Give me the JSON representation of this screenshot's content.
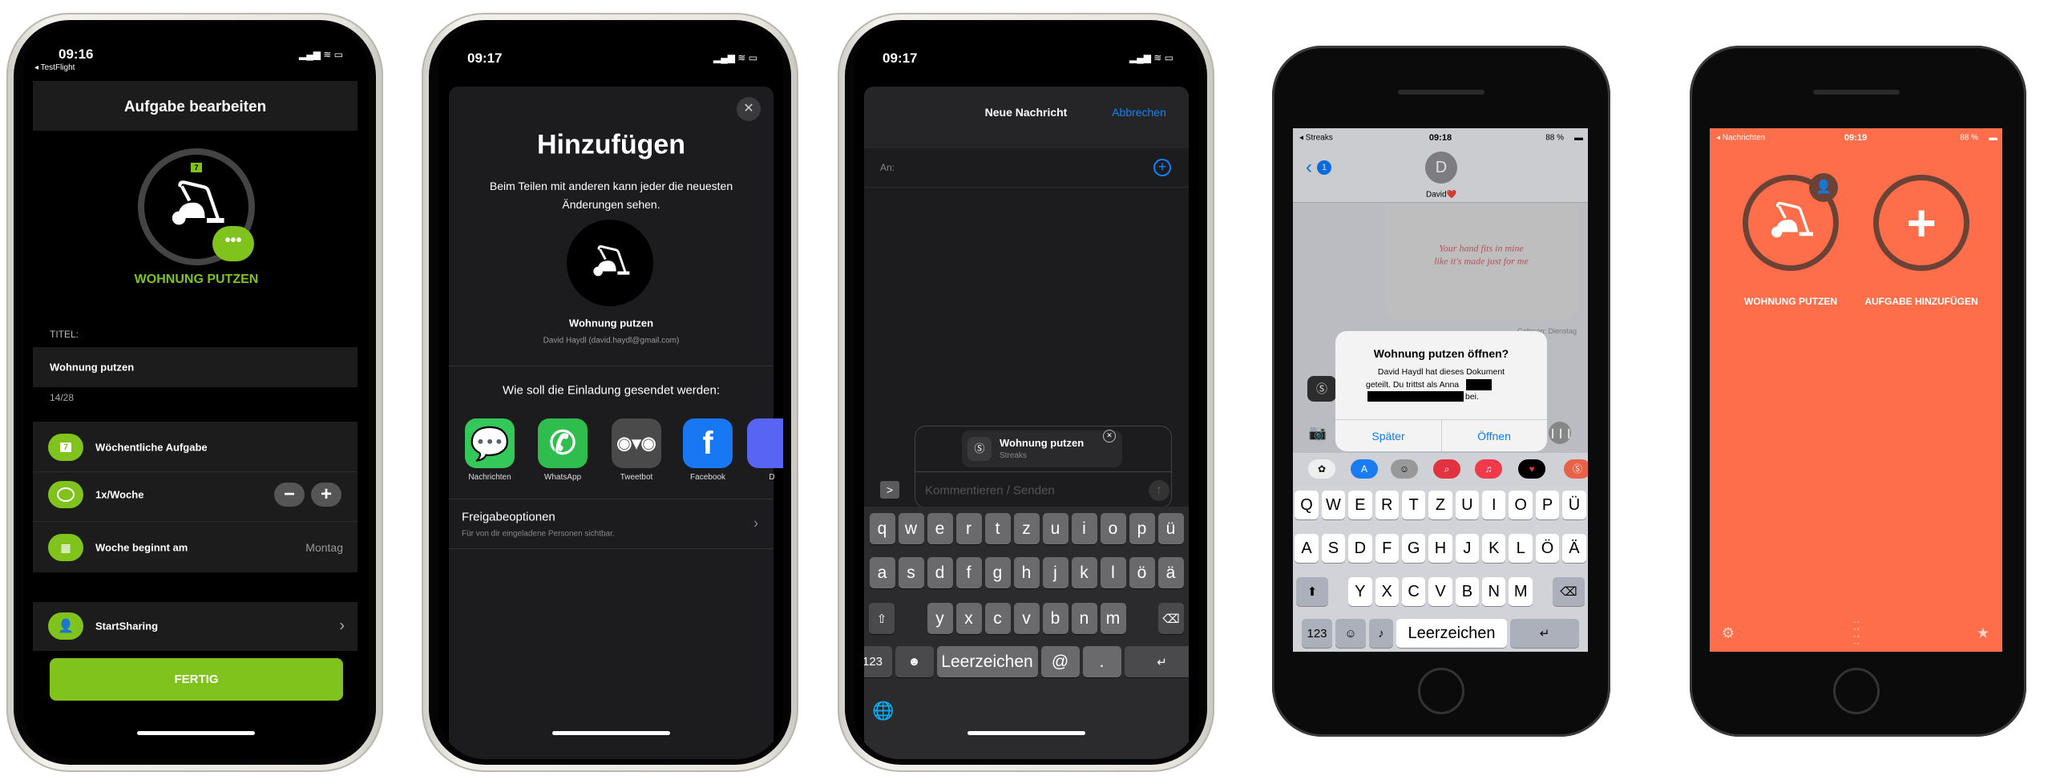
{
  "phone1": {
    "status": {
      "time": "09:16",
      "back_app": "◂ TestFlight"
    },
    "header_title": "Aufgabe bearbeiten",
    "task_badge": "7",
    "task_name_caps": "WOHNUNG PUTZEN",
    "title_label": "TITEL:",
    "title_value": "Wohnung putzen",
    "char_count": "14/28",
    "rows": [
      {
        "icon": "calendar-7-icon",
        "badge": "7",
        "label": "Wöchentliche Aufgabe"
      },
      {
        "icon": "circle-icon",
        "label": "1x/Woche",
        "minus": "−",
        "plus": "+"
      },
      {
        "icon": "calendar-grid-icon",
        "label": "Woche beginnt am",
        "value": "Montag"
      }
    ],
    "sharing_label": "StartSharing",
    "done_button": "FERTIG",
    "accent": "#7fc31c"
  },
  "phone2": {
    "status": {
      "time": "09:17"
    },
    "title": "Hinzufügen",
    "description_1": "Beim Teilen mit anderen kann jeder die neuesten",
    "description_2": "Änderungen sehen.",
    "item_name": "Wohnung putzen",
    "owner": "David Haydl (david.haydl@gmail.com)",
    "send_prompt": "Wie soll die Einladung gesendet werden:",
    "apps": [
      {
        "label": "Nachrichten",
        "icon": "messages-icon",
        "color": "#34c759"
      },
      {
        "label": "WhatsApp",
        "icon": "whatsapp-icon",
        "color": "#2fbe4e"
      },
      {
        "label": "Tweetbot",
        "icon": "tweetbot-icon",
        "color": "#4a4a4a"
      },
      {
        "label": "Facebook",
        "icon": "facebook-icon",
        "color": "#1877f2"
      },
      {
        "label": "D",
        "icon": "discord-icon",
        "color": "#5865f2"
      }
    ],
    "options_title": "Freigabeoptionen",
    "options_subtitle": "Für von dir eingeladene Personen sichtbar."
  },
  "phone3": {
    "status": {
      "time": "09:17"
    },
    "title": "Neue Nachricht",
    "cancel": "Abbrechen",
    "to_label": "An:",
    "attachment_title": "Wohnung putzen",
    "attachment_app": "Streaks",
    "compose_placeholder": "Kommentieren / Senden",
    "keyboard": [
      [
        {
          "label": "q"
        },
        {
          "label": "w"
        },
        {
          "label": "e"
        },
        {
          "label": "r"
        },
        {
          "label": "t"
        },
        {
          "label": "z"
        },
        {
          "label": "u"
        },
        {
          "label": "i"
        },
        {
          "label": "o"
        },
        {
          "label": "p"
        },
        {
          "label": "ü"
        }
      ],
      [
        {
          "label": "a"
        },
        {
          "label": "s"
        },
        {
          "label": "d"
        },
        {
          "label": "f"
        },
        {
          "label": "g"
        },
        {
          "label": "h"
        },
        {
          "label": "j"
        },
        {
          "label": "k"
        },
        {
          "label": "l"
        },
        {
          "label": "ö"
        },
        {
          "label": "ä"
        }
      ],
      [
        {
          "label": "⇧",
          "icon": "shift-icon"
        },
        {
          "label": "y"
        },
        {
          "label": "x"
        },
        {
          "label": "c"
        },
        {
          "label": "v"
        },
        {
          "label": "b"
        },
        {
          "label": "n"
        },
        {
          "label": "m"
        },
        {
          "label": "⌫",
          "icon": "delete-icon"
        }
      ],
      [
        {
          "label": "123",
          "icon": "numbers-key"
        },
        {
          "label": "☻",
          "icon": "emoji-icon"
        },
        {
          "label": "Leerzeichen",
          "icon": "space-key"
        },
        {
          "label": "@",
          "icon": "at-key"
        },
        {
          "label": ".",
          "icon": "period-key"
        },
        {
          "label": "↵",
          "icon": "return-icon"
        }
      ]
    ]
  },
  "phone4": {
    "status": {
      "back_app": "◂ Streaks",
      "time": "09:18",
      "battery": "88 %"
    },
    "back_badge": "1",
    "contact_initial": "D",
    "contact_name": "David❤️",
    "handwriting_1": "Your hand fits in mine",
    "handwriting_2": "like it's made just for me",
    "read_receipt": "Gelesen: Dienstag",
    "alert": {
      "title": "Wohnung putzen öffnen?",
      "body_1": "David Haydl hat dieses Dokument",
      "body_2": "geteilt. Du trittst als Anna",
      "body_3": "bei.",
      "later": "Später",
      "open": "Öffnen"
    },
    "keyboard": [
      [
        {
          "label": "Q"
        },
        {
          "label": "W"
        },
        {
          "label": "E"
        },
        {
          "label": "R"
        },
        {
          "label": "T"
        },
        {
          "label": "Z"
        },
        {
          "label": "U"
        },
        {
          "label": "I"
        },
        {
          "label": "O"
        },
        {
          "label": "P"
        },
        {
          "label": "Ü"
        }
      ],
      [
        {
          "label": "A"
        },
        {
          "label": "S"
        },
        {
          "label": "D"
        },
        {
          "label": "F"
        },
        {
          "label": "G"
        },
        {
          "label": "H"
        },
        {
          "label": "J"
        },
        {
          "label": "K"
        },
        {
          "label": "L"
        },
        {
          "label": "Ö"
        },
        {
          "label": "Ä"
        }
      ],
      [
        {
          "label": "⬆",
          "icon": "shift-icon"
        },
        {
          "label": "Y"
        },
        {
          "label": "X"
        },
        {
          "label": "C"
        },
        {
          "label": "V"
        },
        {
          "label": "B"
        },
        {
          "label": "N"
        },
        {
          "label": "M"
        },
        {
          "label": "⌫",
          "icon": "delete-icon"
        }
      ],
      [
        {
          "label": "123",
          "icon": "numbers-key"
        },
        {
          "label": "☺",
          "icon": "emoji-icon"
        },
        {
          "label": "♪",
          "icon": "microphone-icon"
        },
        {
          "label": "Leerzeichen",
          "icon": "space-key"
        },
        {
          "label": "↵",
          "icon": "return-icon"
        }
      ]
    ]
  },
  "phone5": {
    "status": {
      "back_app": "◂ Nachrichten",
      "time": "09:19",
      "battery": "88 %"
    },
    "tasks": [
      {
        "label": "WOHNUNG PUTZEN",
        "icon": "vacuum-icon"
      },
      {
        "label": "AUFGABE HINZUFÜGEN",
        "icon": "plus-icon"
      }
    ],
    "background": "#ff6e4a"
  }
}
